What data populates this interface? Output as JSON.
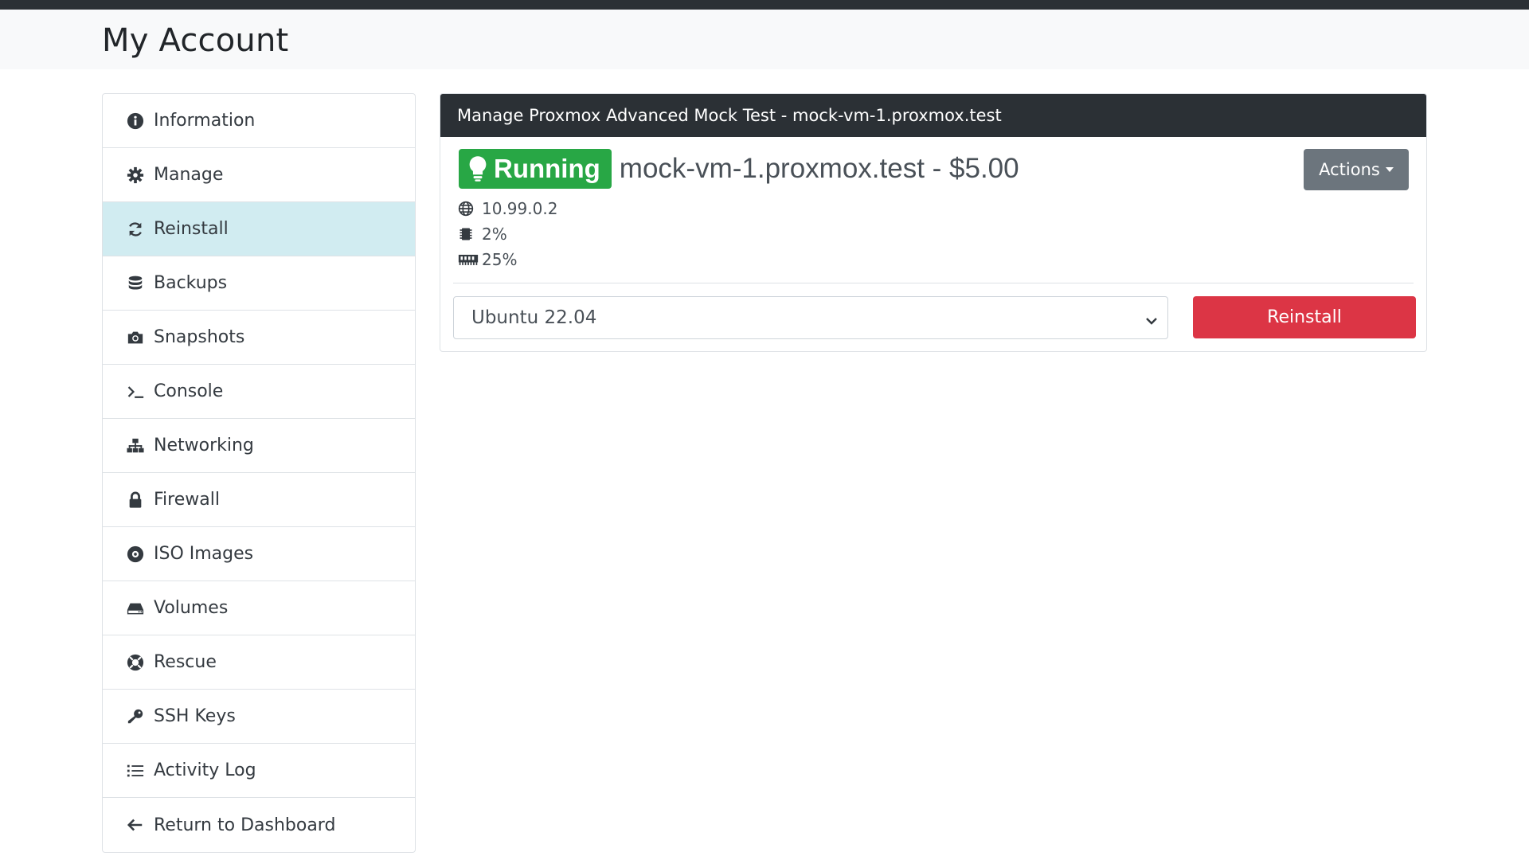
{
  "page": {
    "title": "My Account"
  },
  "sidebar": {
    "items": [
      {
        "label": "Information",
        "icon": "info-circle-icon"
      },
      {
        "label": "Manage",
        "icon": "gear-icon"
      },
      {
        "label": "Reinstall",
        "icon": "refresh-icon",
        "active": true
      },
      {
        "label": "Backups",
        "icon": "database-icon"
      },
      {
        "label": "Snapshots",
        "icon": "camera-icon"
      },
      {
        "label": "Console",
        "icon": "terminal-icon"
      },
      {
        "label": "Networking",
        "icon": "network-icon"
      },
      {
        "label": "Firewall",
        "icon": "lock-icon"
      },
      {
        "label": "ISO Images",
        "icon": "disc-icon"
      },
      {
        "label": "Volumes",
        "icon": "hdd-icon"
      },
      {
        "label": "Rescue",
        "icon": "lifebuoy-icon"
      },
      {
        "label": "SSH Keys",
        "icon": "key-icon"
      },
      {
        "label": "Activity Log",
        "icon": "list-icon"
      },
      {
        "label": "Return to Dashboard",
        "icon": "arrow-left-icon"
      }
    ]
  },
  "card": {
    "header": "Manage Proxmox Advanced Mock Test - mock-vm-1.proxmox.test",
    "status": "Running",
    "status_color": "#28a745",
    "vm_title": "mock-vm-1.proxmox.test - $5.00",
    "ip": "10.99.0.2",
    "cpu": "2%",
    "memory": "25%",
    "actions_label": "Actions",
    "os_select_value": "Ubuntu 22.04",
    "reinstall_label": "Reinstall",
    "reinstall_color": "#dc3545"
  }
}
